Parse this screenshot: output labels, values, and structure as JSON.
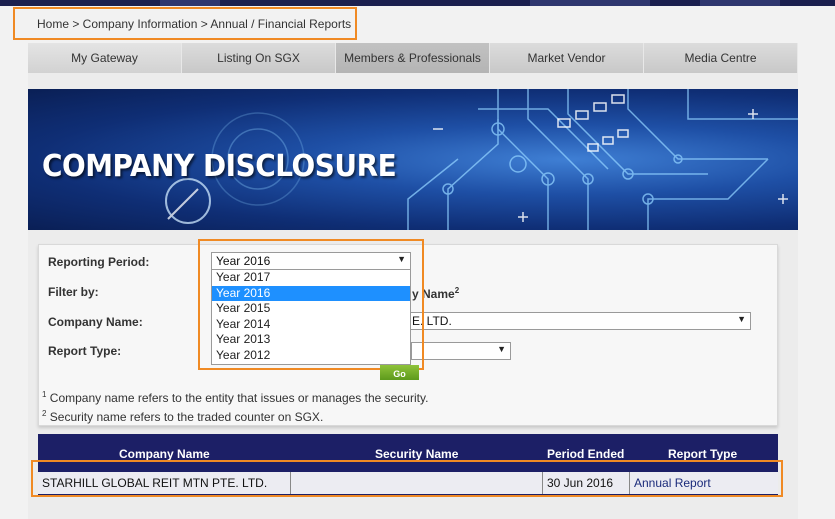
{
  "breadcrumb": {
    "text": "Home > Company Information > Annual / Financial Reports"
  },
  "nav": {
    "tabs": [
      "My Gateway",
      "Listing On SGX",
      "Members & Professionals",
      "Market Vendor",
      "Media Centre"
    ]
  },
  "banner": {
    "title": "COMPANY DISCLOSURE"
  },
  "filters": {
    "reporting_period_label": "Reporting Period:",
    "reporting_period_value": "Year 2016",
    "filter_by_label": "Filter by:",
    "filter_by_partial": "y Name",
    "filter_by_sup": "2",
    "company_name_label": "Company Name:",
    "company_name_partial": "E. LTD.",
    "report_type_label": "Report Type:",
    "go_label": "Go"
  },
  "year_options": [
    {
      "label": "Year 2017",
      "selected": false
    },
    {
      "label": "Year 2016",
      "selected": true
    },
    {
      "label": "Year 2015",
      "selected": false
    },
    {
      "label": "Year 2014",
      "selected": false
    },
    {
      "label": "Year 2013",
      "selected": false
    },
    {
      "label": "Year 2012",
      "selected": false
    }
  ],
  "footnotes": {
    "note1_sup": "1",
    "note1": "Company name refers to the entity that issues or manages the security.",
    "note2_sup": "2",
    "note2": "Security name refers to the traded counter on SGX."
  },
  "table": {
    "headers": [
      "Company Name",
      "Security Name",
      "Period Ended",
      "Report Type"
    ],
    "rows": [
      [
        "STARHILL GLOBAL REIT MTN PTE. LTD.",
        "",
        "30 Jun 2016",
        "Annual Report"
      ]
    ]
  },
  "colors": {
    "highlight": "#f08a24",
    "table_header": "#1c1f66",
    "selected_option": "#1e90ff",
    "go_button": "#6aa624"
  }
}
